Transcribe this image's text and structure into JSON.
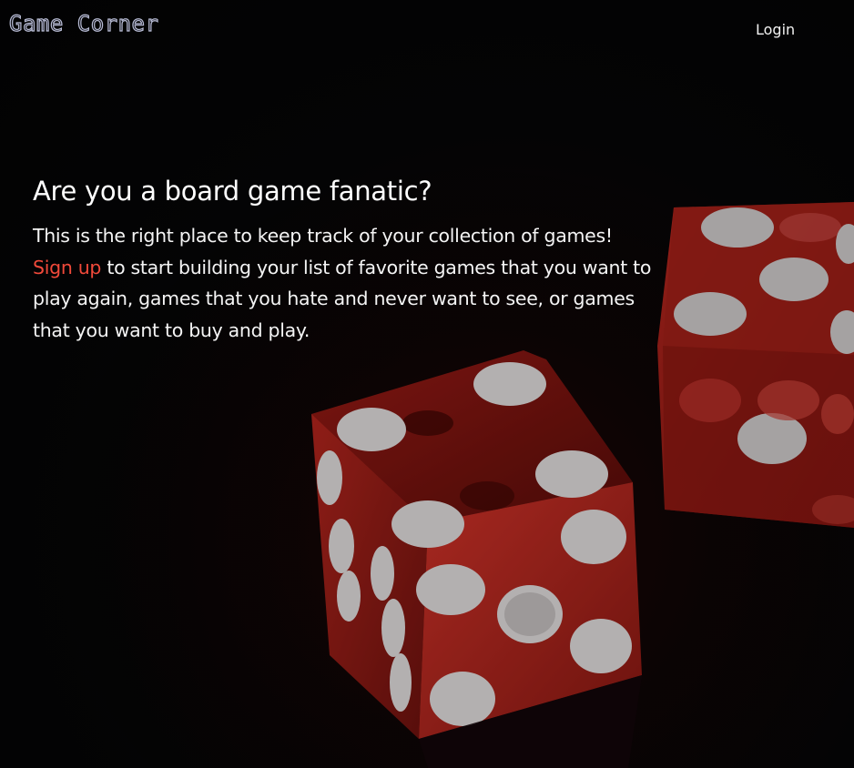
{
  "header": {
    "brand": "Game Corner",
    "login_label": "Login"
  },
  "hero": {
    "title": "Are you a board game fanatic?",
    "line1": "This is the right place to keep track of your collection of games!",
    "signup_label": "Sign up",
    "line2_rest": " to start building your list of favorite games that you want to play again, games that you hate and never want to see, or games that you want to buy and play."
  },
  "colors": {
    "background": "#050506",
    "text": "#ffffff",
    "accent": "#f0493a",
    "brand_outline": "#b9bdd6",
    "dice_red": "#c4221c",
    "pip_white": "#e6e2e2"
  },
  "icons": {
    "background_art": "red-dice-photo"
  }
}
